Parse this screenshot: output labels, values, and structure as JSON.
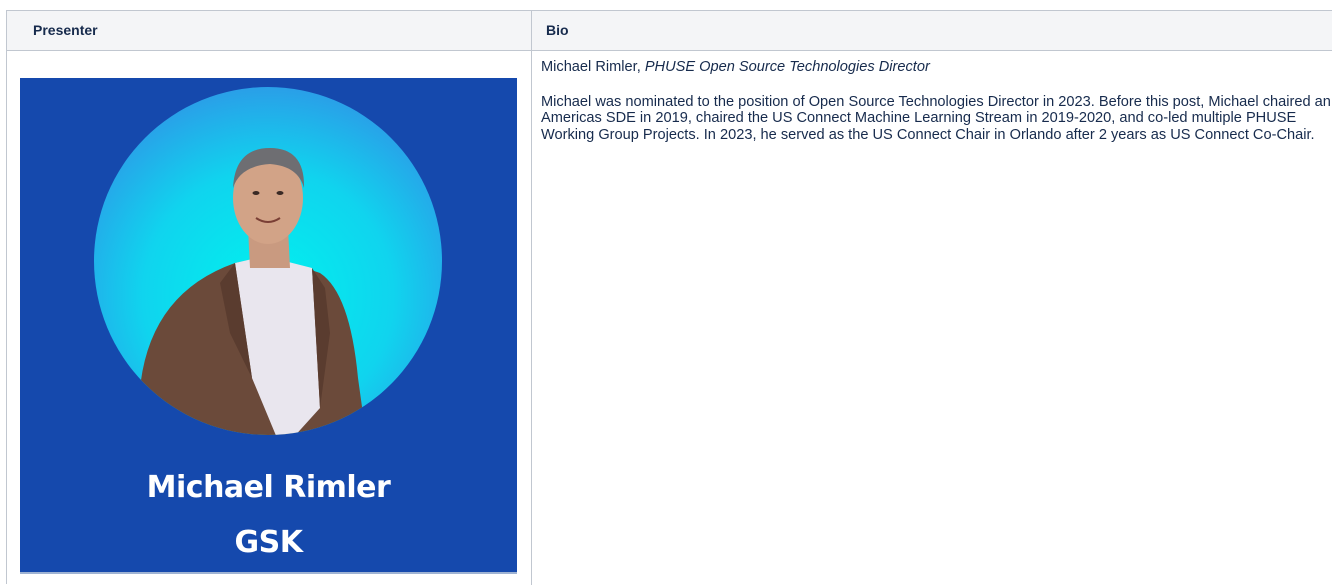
{
  "table": {
    "headers": {
      "presenter": "Presenter",
      "bio": "Bio"
    },
    "presenter": {
      "photo_alt": "Michael Rimler photo",
      "caption_name": "Michael Rimler",
      "caption_org": "GSK",
      "colors": {
        "background": "#1549ad",
        "circle_inner": "#00e8ef",
        "circle_outer": "#1fb6ee"
      }
    },
    "bio": {
      "name": "Michael Rimler",
      "separator": ",",
      "title": "PHUSE Open Source Technologies Director",
      "paragraph": "Michael was nominated to the position of Open Source Technologies Director in 2023. Before this post, Michael chaired an Americas SDE in 2019, chaired the US Connect Machine Learning Stream in 2019-2020, and co-led multiple PHUSE Working Group Projects. In 2023, he served as the US Connect Chair in Orlando after 2 years as US Connect Co-Chair."
    }
  }
}
